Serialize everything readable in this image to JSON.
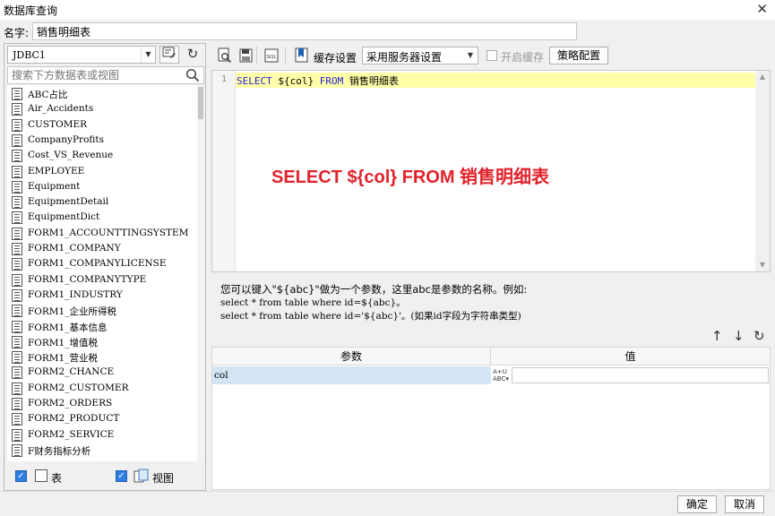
{
  "window": {
    "title": "数据库查询",
    "close_glyph": "✕"
  },
  "name_row": {
    "label": "名字:",
    "value": "销售明细表"
  },
  "left_panel": {
    "datasource": "JDBC1",
    "search_placeholder": "搜索下方数据表或视图",
    "tables": [
      "ABC占比",
      "Air_Accidents",
      "CUSTOMER",
      "CompanyProfits",
      "Cost_VS_Revenue",
      "EMPLOYEE",
      "Equipment",
      "EquipmentDetail",
      "EquipmentDict",
      "FORM1_ACCOUNTTINGSYSTEM",
      "FORM1_COMPANY",
      "FORM1_COMPANYLICENSE",
      "FORM1_COMPANYTYPE",
      "FORM1_INDUSTRY",
      "FORM1_企业所得税",
      "FORM1_基本信息",
      "FORM1_增值税",
      "FORM1_营业税",
      "FORM2_CHANCE",
      "FORM2_CUSTOMER",
      "FORM2_ORDERS",
      "FORM2_PRODUCT",
      "FORM2_SERVICE",
      "F财务指标分析"
    ],
    "footer": {
      "table_label": "表",
      "view_label": "视图"
    }
  },
  "toolbar": {
    "cache_settings_label": "缓存设置",
    "cache_option": "采用服务器设置",
    "enable_cache_label": "开启缓存",
    "policy_button": "策略配置"
  },
  "editor": {
    "line_number": "1",
    "sql": {
      "kw1": "SELECT",
      "mid": " ${col} ",
      "kw2": "FROM",
      "tail": " 销售明细表"
    },
    "annotation": "SELECT ${col} FROM 销售明细表"
  },
  "help": {
    "line1": "您可以键入\"${abc}\"做为一个参数，这里abc是参数的名称。例如:",
    "line2": "select * from table where id=${abc}。",
    "line3": "select * from table where id='${abc}'。(如果id字段为字符串类型)"
  },
  "params": {
    "header_param": "参数",
    "header_value": "值",
    "rows": [
      {
        "name": "col",
        "value": ""
      }
    ]
  },
  "buttons": {
    "ok": "确定",
    "cancel": "取消"
  },
  "colors": {
    "annotation": "#e2222a",
    "keyword": "#1f1fd0",
    "current_line": "#ffffaa",
    "checkbox": "#2f7ee0"
  }
}
